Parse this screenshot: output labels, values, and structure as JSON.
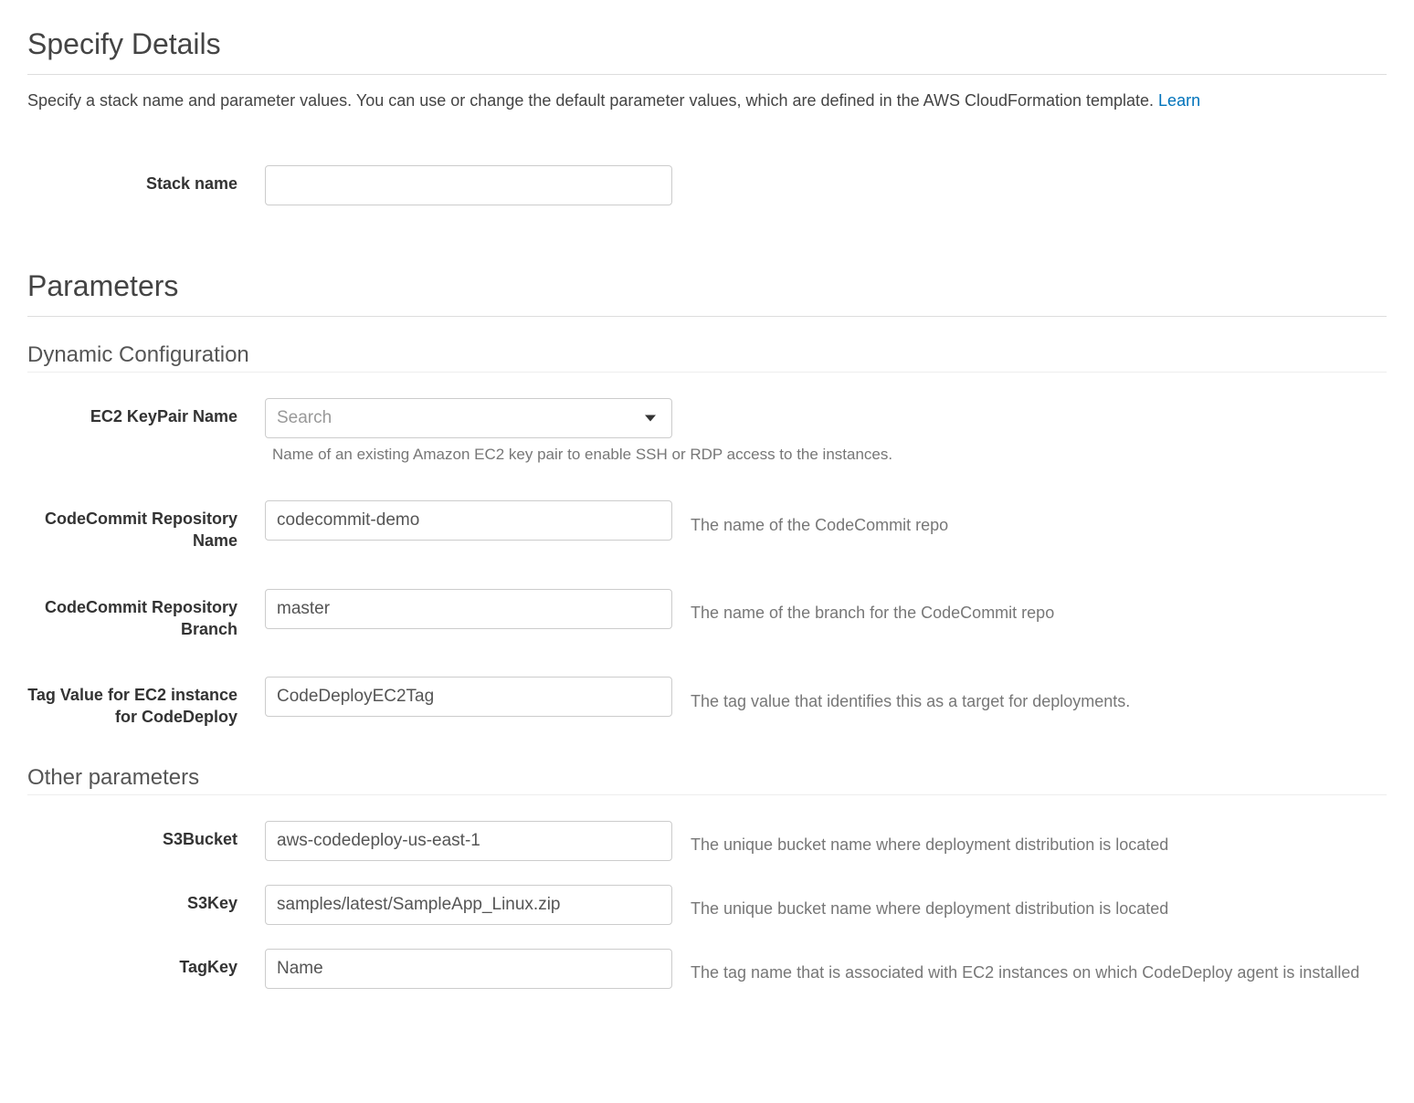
{
  "header": {
    "title": "Specify Details",
    "intro": "Specify a stack name and parameter values. You can use or change the default parameter values, which are defined in the AWS CloudFormation template. ",
    "learn_link": "Learn"
  },
  "stack": {
    "label": "Stack name",
    "value": ""
  },
  "parameters_heading": "Parameters",
  "dynamic_config": {
    "heading": "Dynamic Configuration",
    "ec2_keypair": {
      "label": "EC2 KeyPair Name",
      "placeholder": "Search",
      "help": "Name of an existing Amazon EC2 key pair to enable SSH or RDP access to the instances."
    },
    "repo_name": {
      "label": "CodeCommit Repository Name",
      "value": "codecommit-demo",
      "help": "The name of the CodeCommit repo"
    },
    "repo_branch": {
      "label": "CodeCommit Repository Branch",
      "value": "master",
      "help": "The name of the branch for the CodeCommit repo"
    },
    "tag_value": {
      "label": "Tag Value for EC2 instance for CodeDeploy",
      "value": "CodeDeployEC2Tag",
      "help": "The tag value that identifies this as a target for deployments."
    }
  },
  "other_params": {
    "heading": "Other parameters",
    "s3bucket": {
      "label": "S3Bucket",
      "value": "aws-codedeploy-us-east-1",
      "help": "The unique bucket name where deployment distribution is located"
    },
    "s3key": {
      "label": "S3Key",
      "value": "samples/latest/SampleApp_Linux.zip",
      "help": "The unique bucket name where deployment distribution is located"
    },
    "tagkey": {
      "label": "TagKey",
      "value": "Name",
      "help": "The tag name that is associated with EC2 instances on which CodeDeploy agent is installed"
    }
  }
}
